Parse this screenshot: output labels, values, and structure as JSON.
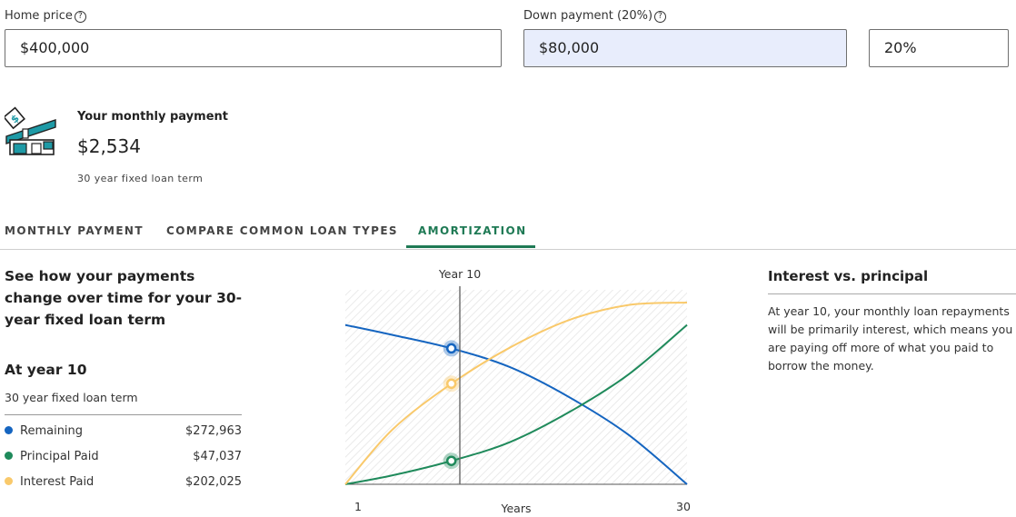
{
  "inputs": {
    "home_price_label": "Home price",
    "home_price_value": "$400,000",
    "down_payment_label": "Down payment (20%)",
    "down_payment_value": "$80,000",
    "down_payment_percent": "20%",
    "help_glyph": "?"
  },
  "payment": {
    "title": "Your monthly payment",
    "amount": "$2,534",
    "term": "30 year fixed loan term"
  },
  "tabs": [
    {
      "label": "MONTHLY PAYMENT",
      "active": false
    },
    {
      "label": "COMPARE COMMON LOAN TYPES",
      "active": false
    },
    {
      "label": "AMORTIZATION",
      "active": true
    }
  ],
  "amortization": {
    "heading": "See how your payments change over time for your 30-year fixed loan term",
    "year_heading": "At year 10",
    "term": "30 year fixed loan term",
    "rows": [
      {
        "label": "Remaining",
        "value": "$272,963",
        "color": "#1565c0"
      },
      {
        "label": "Principal Paid",
        "value": "$47,037",
        "color": "#1f8a5b"
      },
      {
        "label": "Interest Paid",
        "value": "$202,025",
        "color": "#f9c96b"
      }
    ]
  },
  "chart_data": {
    "type": "line",
    "marker_label": "Year 10",
    "marker_year": 10,
    "xlabel": "Years",
    "x_ticks": [
      "1",
      "30"
    ],
    "xlim": [
      1,
      30
    ],
    "series": [
      {
        "label": "Remaining",
        "color": "#1565c0",
        "x": [
          1,
          5,
          10,
          15,
          20,
          25,
          30
        ],
        "y": [
          320000,
          300000,
          272963,
          235000,
          175000,
          100000,
          0
        ]
      },
      {
        "label": "Principal Paid",
        "color": "#1f8a5b",
        "x": [
          1,
          5,
          10,
          15,
          20,
          25,
          30
        ],
        "y": [
          0,
          18000,
          47037,
          85000,
          145000,
          220000,
          320000
        ]
      },
      {
        "label": "Interest Paid",
        "color": "#f9c96b",
        "x": [
          1,
          5,
          10,
          15,
          20,
          25,
          30
        ],
        "y": [
          0,
          110000,
          202025,
          275000,
          330000,
          360000,
          365000
        ]
      }
    ]
  },
  "side_note": {
    "title": "Interest vs. principal",
    "body": "At year 10, your monthly loan repayments will be primarily interest, which means you are paying off more of what you paid to borrow the money."
  }
}
